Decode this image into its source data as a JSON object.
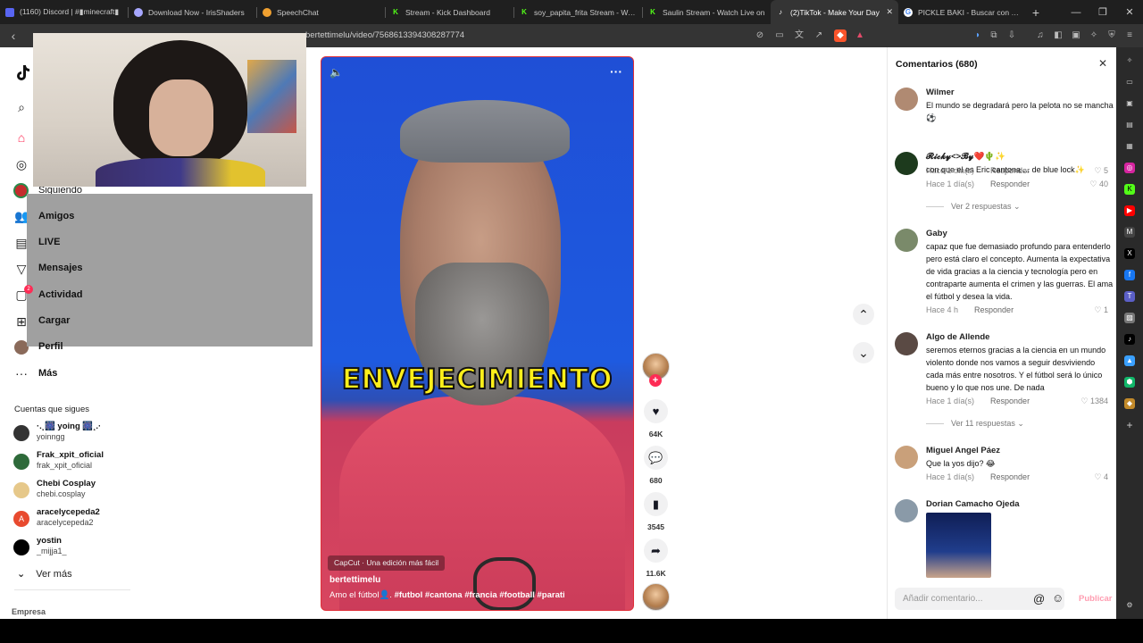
{
  "browser": {
    "tabs": [
      {
        "title": "(1160) Discord | #▮minecraft▮",
        "icon": "discord-icon",
        "color": "#5865f2"
      },
      {
        "title": "Download Now - IrisShaders",
        "icon": "iris-icon",
        "color": "#a7a7ff"
      },
      {
        "title": "SpeechChat",
        "icon": "speechchat-icon",
        "color": "#f0a030"
      },
      {
        "title": "Stream - Kick Dashboard",
        "icon": "kick-icon",
        "color": "#53fc18"
      },
      {
        "title": "soy_papita_frita Stream - Watch",
        "icon": "kick-icon",
        "color": "#53fc18"
      },
      {
        "title": "Saulin Stream - Watch Live on",
        "icon": "kick-icon",
        "color": "#53fc18"
      },
      {
        "title": "(2)TikTok - Make Your Day",
        "icon": "tiktok-icon",
        "color": "#ffffff",
        "active": true
      },
      {
        "title": "PICKLE BAKI - Buscar con Goo",
        "icon": "google-icon",
        "color": "#4285f4"
      }
    ],
    "url": "bertettimelu/video/7568613394308287774"
  },
  "tiktok": {
    "nav": {
      "following": "Siguiendo",
      "friends": "Amigos",
      "live": "LIVE",
      "messages": "Mensajes",
      "activity": "Actividad",
      "activity_badge": "2",
      "upload": "Cargar",
      "profile": "Perfil",
      "more": "Más"
    },
    "following_section": "Cuentas que sigues",
    "accounts": [
      {
        "name": "·.¸🎆 yoing 🎆¸.·",
        "handle": "yoinngg",
        "color": "#333"
      },
      {
        "name": "Frak_xpit_oficial",
        "handle": "frak_xpit_oficial",
        "color": "#2e6a3a"
      },
      {
        "name": "Chebi Cosplay",
        "handle": "chebi.cosplay",
        "color": "#e6c88a"
      },
      {
        "name": "aracelycepeda2",
        "handle": "aracelycepeda2",
        "color": "#e84a2f",
        "initial": "A"
      },
      {
        "name": "yostin",
        "handle": "_mijja1_",
        "color": "#000"
      }
    ],
    "see_more": "Ver más",
    "company": "Empresa",
    "video": {
      "caption": "ENVEJECIMIENTO",
      "capcut": "CapCut · Una edición más fácil",
      "author": "bertettimelu",
      "desc_prefix": "Amo el fútbol👤.",
      "hashtags": "#futbol  #cantona  #francia  #football  #parati"
    },
    "actions": {
      "likes": "64K",
      "comments": "680",
      "saves": "3545",
      "shares": "11.6K"
    },
    "comments_panel": {
      "title": "Comentarios (680)",
      "reply_label": "Responder",
      "input_placeholder": "Añadir comentario...",
      "post_label": "Publicar",
      "comments": [
        {
          "name": "Wilmer",
          "text": "El mundo se degradará pero la pelota no se mancha ⚽",
          "time": "Hace 1 día(s)",
          "likes": "5"
        },
        {
          "name": "𝓡𝓲𝓬𝓴𝔂<>𝓑𝔂❤️🌵✨",
          "text": "con que el es Eric cantona ... de blue lock✨",
          "time": "Hace 1 día(s)",
          "likes": "40",
          "replies": "Ver 2 respuestas"
        },
        {
          "name": "Gaby",
          "text": "capaz que fue demasiado profundo para entenderlo pero está claro el concepto. Aumenta la expectativa de vida gracias a la ciencia y tecnología pero en contraparte aumenta el crimen y las guerras. El ama el fútbol y desea la vida.",
          "time": "Hace 4 h",
          "likes": "1"
        },
        {
          "name": "Algo de Allende",
          "text": "seremos eternos gracias a la ciencia en un mundo violento donde nos vamos a seguir desviviendo cada más entre nosotros. Y el fútbol será lo único bueno y lo que nos une. De nada",
          "time": "Hace 1 día(s)",
          "likes": "1384",
          "replies": "Ver 11 respuestas"
        },
        {
          "name": "Miguel Angel Páez",
          "text": "Que la yos dijo? 😂",
          "time": "Hace 1 día(s)",
          "likes": "4"
        },
        {
          "name": "Dorian Camacho Ojeda",
          "text": "",
          "time": "",
          "likes": ""
        }
      ]
    }
  },
  "colors": {
    "tiktok_red": "#fe2c55",
    "caption_yellow": "#ffef1a",
    "chrome_dark": "#1f1f1f"
  }
}
